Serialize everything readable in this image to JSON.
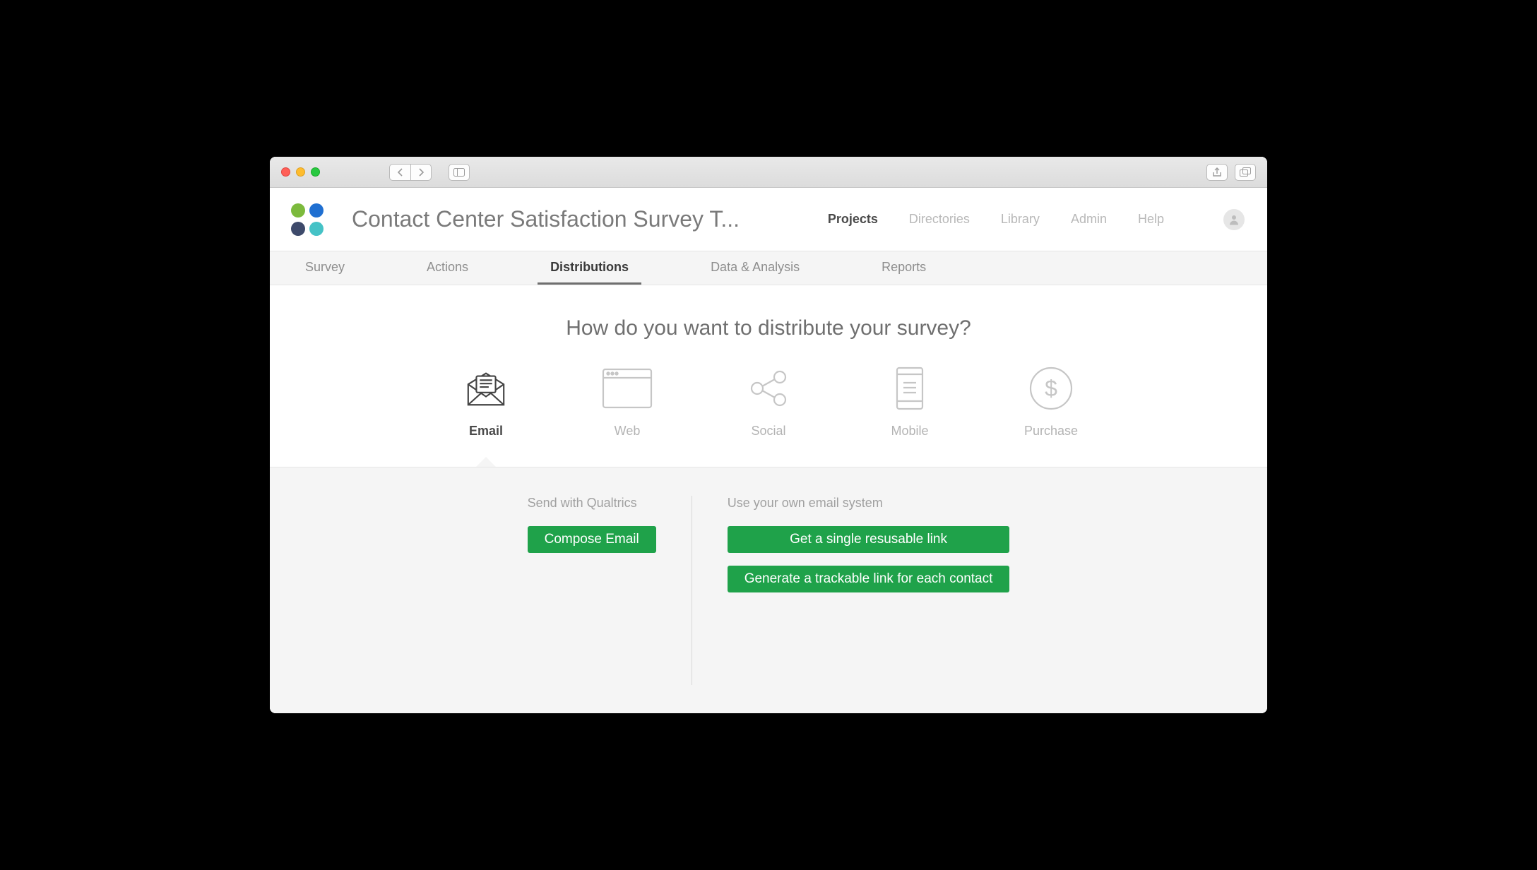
{
  "header": {
    "project_title": "Contact Center Satisfaction Survey T...",
    "nav": [
      {
        "label": "Projects",
        "active": true
      },
      {
        "label": "Directories",
        "active": false
      },
      {
        "label": "Library",
        "active": false
      },
      {
        "label": "Admin",
        "active": false
      },
      {
        "label": "Help",
        "active": false
      }
    ]
  },
  "subnav": [
    {
      "label": "Survey",
      "active": false
    },
    {
      "label": "Actions",
      "active": false
    },
    {
      "label": "Distributions",
      "active": true
    },
    {
      "label": "Data & Analysis",
      "active": false
    },
    {
      "label": "Reports",
      "active": false
    }
  ],
  "main": {
    "question": "How do you want to distribute your survey?",
    "channels": [
      {
        "key": "email",
        "label": "Email",
        "active": true
      },
      {
        "key": "web",
        "label": "Web",
        "active": false
      },
      {
        "key": "social",
        "label": "Social",
        "active": false
      },
      {
        "key": "mobile",
        "label": "Mobile",
        "active": false
      },
      {
        "key": "purchase",
        "label": "Purchase",
        "active": false
      }
    ]
  },
  "panel": {
    "left": {
      "heading": "Send with Qualtrics",
      "button": "Compose Email"
    },
    "right": {
      "heading": "Use your own email system",
      "button1": "Get a single resusable link",
      "button2": "Generate a trackable link for each contact"
    }
  }
}
